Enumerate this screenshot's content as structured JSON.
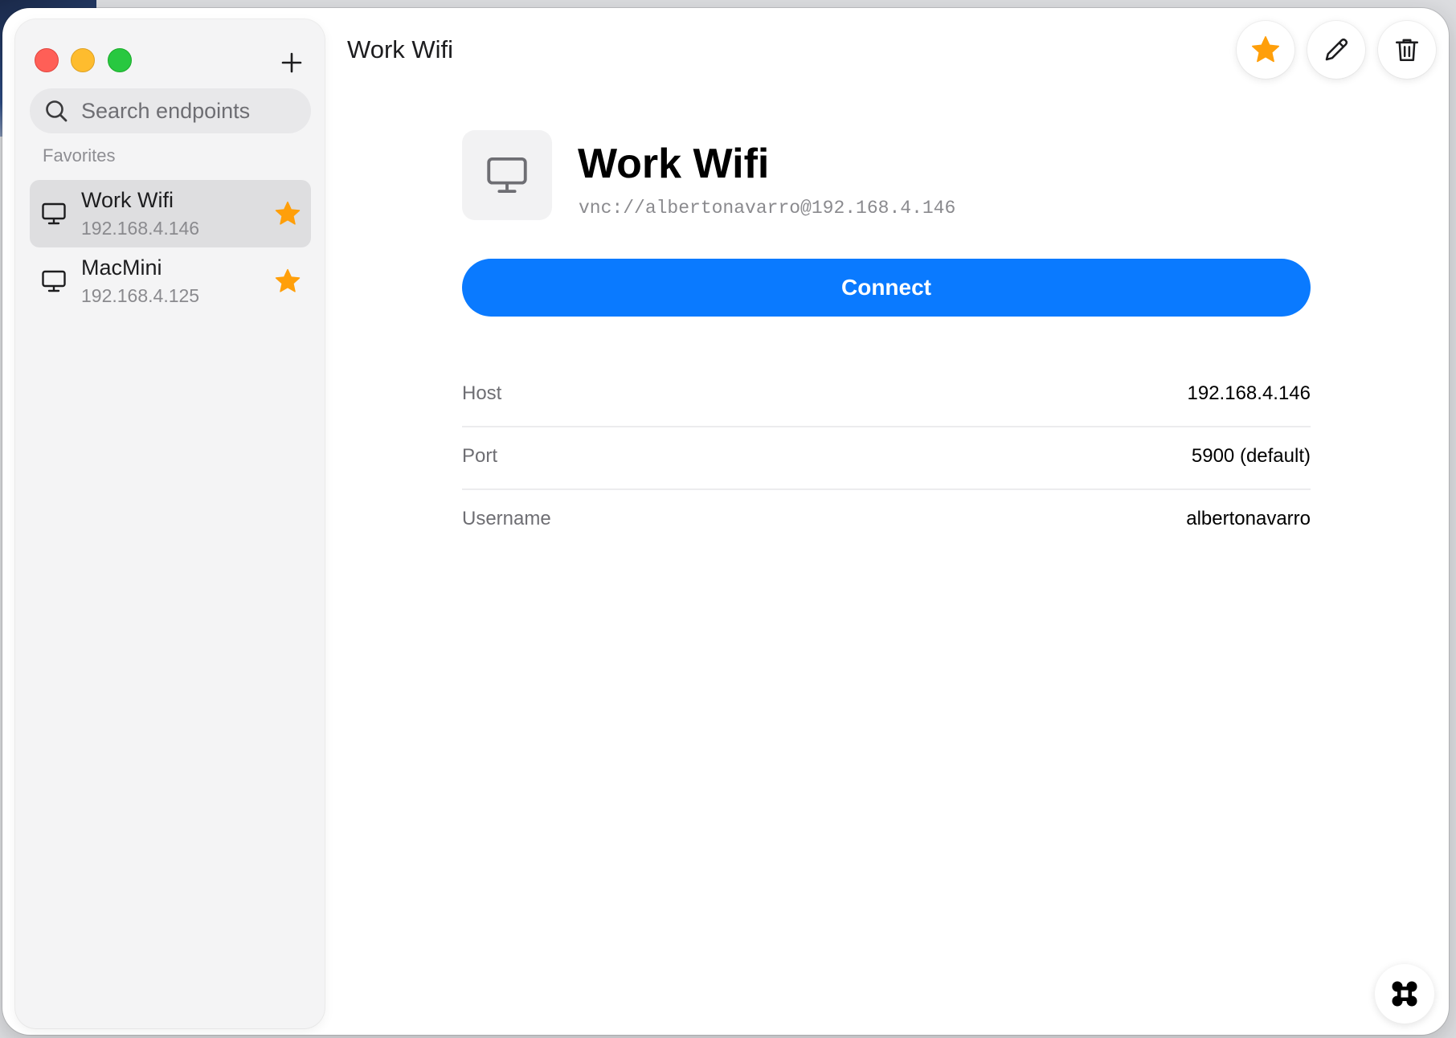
{
  "window": {
    "title": "Work Wifi"
  },
  "sidebar": {
    "search_placeholder": "Search endpoints",
    "section_label": "Favorites",
    "items": [
      {
        "name": "Work Wifi",
        "ip": "192.168.4.146",
        "favorite": true,
        "selected": true,
        "icon": "monitor-icon"
      },
      {
        "name": "MacMini",
        "ip": "192.168.4.125",
        "favorite": true,
        "selected": false,
        "icon": "monitor-icon"
      }
    ]
  },
  "toolbar": {
    "buttons": [
      "star-icon",
      "pencil-icon",
      "trash-icon"
    ]
  },
  "detail": {
    "title": "Work Wifi",
    "url": "vnc://albertonavarro@192.168.4.146",
    "connect_label": "Connect",
    "fields": [
      {
        "label": "Host",
        "value": "192.168.4.146"
      },
      {
        "label": "Port",
        "value": "5900 (default)"
      },
      {
        "label": "Username",
        "value": "albertonavarro"
      }
    ]
  },
  "colors": {
    "accent": "#0a7aff",
    "star": "#ff9f0a",
    "close": "#ff5f57",
    "minimize": "#febc2e",
    "maximize": "#28c840"
  }
}
